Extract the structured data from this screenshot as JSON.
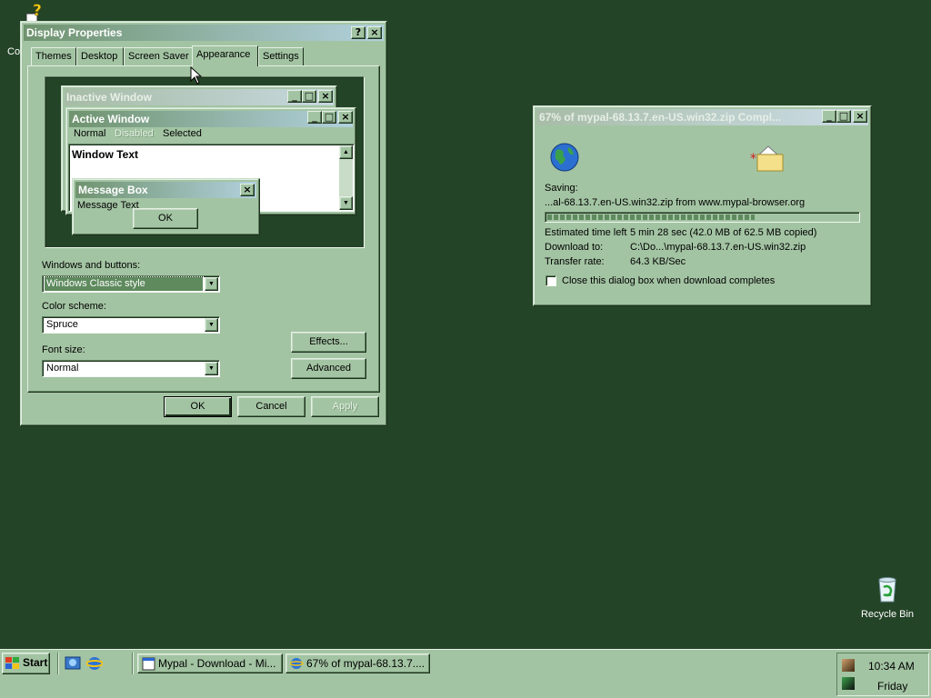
{
  "desktop": {
    "top_icon_label": "Co",
    "recycle_bin_label": "Recycle Bin"
  },
  "display_properties": {
    "title": "Display Properties",
    "help_btn": "?",
    "close_btn": "×",
    "tabs": [
      "Themes",
      "Desktop",
      "Screen Saver",
      "Appearance",
      "Settings"
    ],
    "preview": {
      "inactive_title": "Inactive Window",
      "active_title": "Active Window",
      "menu_normal": "Normal",
      "menu_disabled": "Disabled",
      "menu_selected": "Selected",
      "window_text": "Window Text",
      "msgbox_title": "Message Box",
      "msgbox_text": "Message Text",
      "msgbox_ok": "OK"
    },
    "windows_buttons_label": "Windows and buttons:",
    "windows_buttons_value": "Windows Classic style",
    "color_scheme_label": "Color scheme:",
    "color_scheme_value": "Spruce",
    "font_size_label": "Font size:",
    "font_size_value": "Normal",
    "effects_btn": "Effects...",
    "advanced_btn": "Advanced",
    "ok_btn": "OK",
    "cancel_btn": "Cancel",
    "apply_btn": "Apply"
  },
  "download": {
    "title": "67% of mypal-68.13.7.en-US.win32.zip Compl...",
    "saving_label": "Saving:",
    "saving_text": "...al-68.13.7.en-US.win32.zip from www.mypal-browser.org",
    "progress_percent": 67,
    "time_left_label": "Estimated time left",
    "time_left_value": "5 min 28 sec (42.0 MB of 62.5 MB copied)",
    "download_to_label": "Download to:",
    "download_to_value": "C:\\Do...\\mypal-68.13.7.en-US.win32.zip",
    "transfer_rate_label": "Transfer rate:",
    "transfer_rate_value": "64.3 KB/Sec",
    "close_checkbox_label": "Close this dialog box when download completes"
  },
  "taskbar": {
    "start_label": "Start",
    "tasks": [
      "Mypal - Download - Mi...",
      "67% of mypal-68.13.7...."
    ],
    "clock_time": "10:34 AM",
    "clock_day": "Friday"
  },
  "colors": {
    "desktop": "#244427",
    "face": "#a3c4a3",
    "title_active_start": "#6f936e",
    "title_active_end": "#b1d1dd",
    "progress": "#5e8a5e"
  }
}
